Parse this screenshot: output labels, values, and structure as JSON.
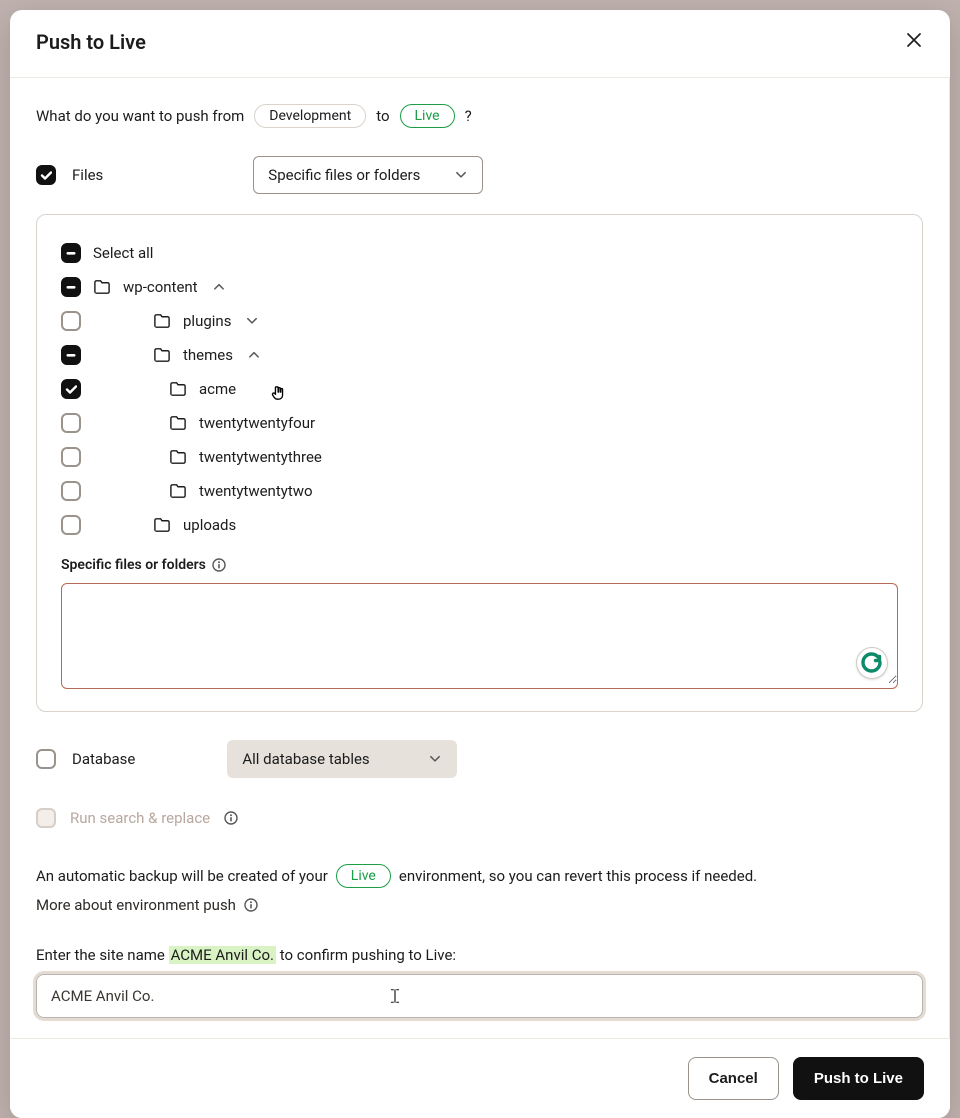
{
  "modal": {
    "title": "Push to Live",
    "question_prefix": "What do you want to push from",
    "question_to": "to",
    "question_suffix": "?",
    "env_from": "Development",
    "env_to": "Live"
  },
  "files": {
    "label": "Files",
    "select_value": "Specific files or folders"
  },
  "tree": {
    "select_all": "Select all",
    "nodes": {
      "wp_content": "wp-content",
      "plugins": "plugins",
      "themes": "themes",
      "acme": "acme",
      "twentytwentyfour": "twentytwentyfour",
      "twentytwentythree": "twentytwentythree",
      "twentytwentytwo": "twentytwentytwo",
      "uploads": "uploads"
    },
    "specific_label": "Specific files or folders",
    "specific_value": ""
  },
  "database": {
    "label": "Database",
    "select_value": "All database tables"
  },
  "search_replace": {
    "label": "Run search & replace"
  },
  "backup": {
    "prefix": "An automatic backup will be created of your",
    "env": "Live",
    "suffix": "environment, so you can revert this process if needed.",
    "link": "More about environment push"
  },
  "confirm": {
    "label_prefix": "Enter the site name",
    "site_name": "ACME Anvil Co.",
    "label_suffix": "to confirm pushing to Live:",
    "value": "ACME Anvil Co."
  },
  "footer": {
    "cancel": "Cancel",
    "submit": "Push to Live"
  }
}
